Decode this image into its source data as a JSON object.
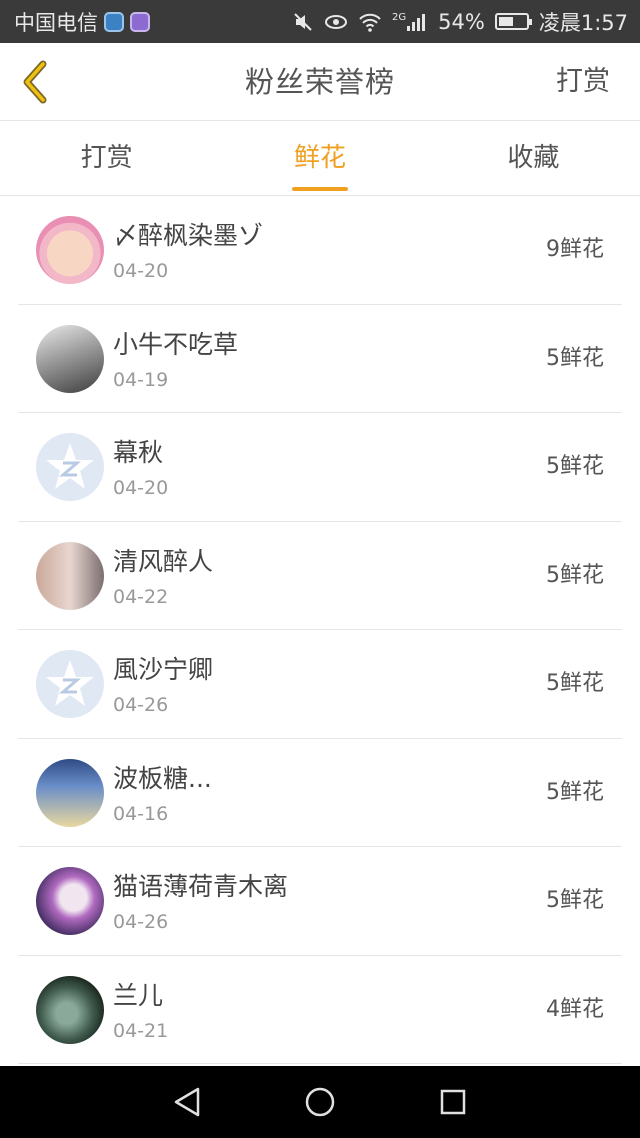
{
  "status_bar": {
    "carrier": "中国电信",
    "signal_type": "2G",
    "battery_percent": "54%",
    "battery_level": 0.54,
    "time": "凌晨1:57"
  },
  "header": {
    "title": "粉丝荣誉榜",
    "action_label": "打赏",
    "back_icon": "chevron-left-icon"
  },
  "tabs": [
    {
      "label": "打赏",
      "active": false
    },
    {
      "label": "鲜花",
      "active": true
    },
    {
      "label": "收藏",
      "active": false
    }
  ],
  "colors": {
    "accent": "#f0a020",
    "status_bar_bg": "#3a3a3a",
    "nav_bar_bg": "#000000",
    "divider": "#e6e6e6"
  },
  "fans": [
    {
      "name": "〆醉枫染墨ゾ",
      "date": "04-20",
      "amount": "9鲜花"
    },
    {
      "name": "小牛不吃草",
      "date": "04-19",
      "amount": "5鲜花"
    },
    {
      "name": "幕秋",
      "date": "04-20",
      "amount": "5鲜花"
    },
    {
      "name": "清风醉人",
      "date": "04-22",
      "amount": "5鲜花"
    },
    {
      "name": "風沙宁卿",
      "date": "04-26",
      "amount": "5鲜花"
    },
    {
      "name": "波板糖...",
      "date": "04-16",
      "amount": "5鲜花"
    },
    {
      "name": "猫语薄荷青木离",
      "date": "04-26",
      "amount": "5鲜花"
    },
    {
      "name": "兰儿",
      "date": "04-21",
      "amount": "4鲜花"
    }
  ],
  "nav_bar": {
    "back_icon": "triangle-back-icon",
    "home_icon": "circle-home-icon",
    "recents_icon": "square-recents-icon"
  }
}
